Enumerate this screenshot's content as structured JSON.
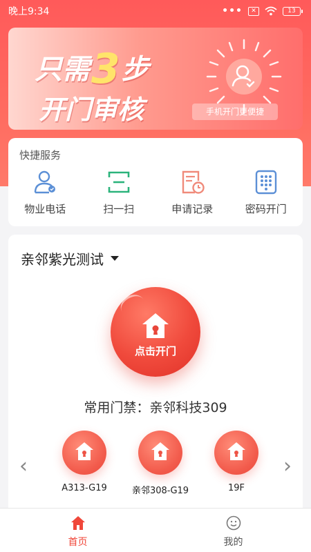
{
  "status": {
    "time": "晚上9:34",
    "dots": "•••",
    "sim": "✕",
    "battery": "13"
  },
  "banner": {
    "line1_a": "只需",
    "line1_num": "3",
    "line1_b": "步",
    "line2": "开门审核",
    "tag": "手机开门更便捷"
  },
  "quick": {
    "title": "快捷服务",
    "items": [
      {
        "label": "物业电话",
        "icon": "user-phone-icon"
      },
      {
        "label": "扫一扫",
        "icon": "scan-icon"
      },
      {
        "label": "申请记录",
        "icon": "record-clock-icon"
      },
      {
        "label": "密码开门",
        "icon": "keypad-icon"
      }
    ]
  },
  "door_panel": {
    "community": "亲邻紫光测试",
    "open_button": "点击开门",
    "common_door": "常用门禁：亲邻科技309",
    "doors": [
      {
        "label": "A313-G19"
      },
      {
        "label": "亲邻308-G19"
      },
      {
        "label": "19F"
      }
    ],
    "prev_arrow": "‹",
    "next_arrow": "›"
  },
  "tabs": [
    {
      "label": "首页",
      "active": true
    },
    {
      "label": "我的",
      "active": false
    }
  ],
  "colors": {
    "primary": "#f0473a",
    "accent_blue": "#5b8fd6",
    "accent_green": "#2bb37b",
    "accent_salmon": "#f08a7a"
  }
}
